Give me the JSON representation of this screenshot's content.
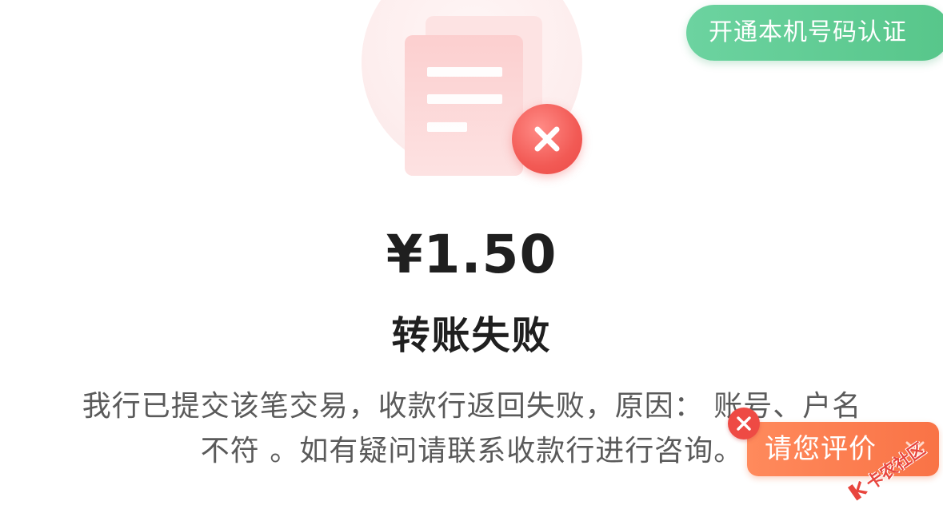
{
  "header": {
    "verify_button_label": "开通本机号码认证"
  },
  "transfer": {
    "amount": "¥1.50",
    "status_title": "转账失败",
    "message_line1": "我行已提交该笔交易，收款行返回失败，原因： 账号、户名",
    "message_line2": "不符 。如有疑问请联系收款行进行咨询。"
  },
  "rating": {
    "label": "请您评价"
  },
  "watermark": {
    "text": "卡农社区"
  },
  "colors": {
    "verify_green": "#57c68a",
    "error_red": "#ec4a46",
    "rating_orange": "#f97346",
    "text_dark": "#1f1f1f",
    "text_gray": "#5a5a5a"
  },
  "icons": {
    "illustration": "failed-document-icon",
    "badge": "close-icon",
    "rating_chevron": "chevron-down-icon"
  }
}
